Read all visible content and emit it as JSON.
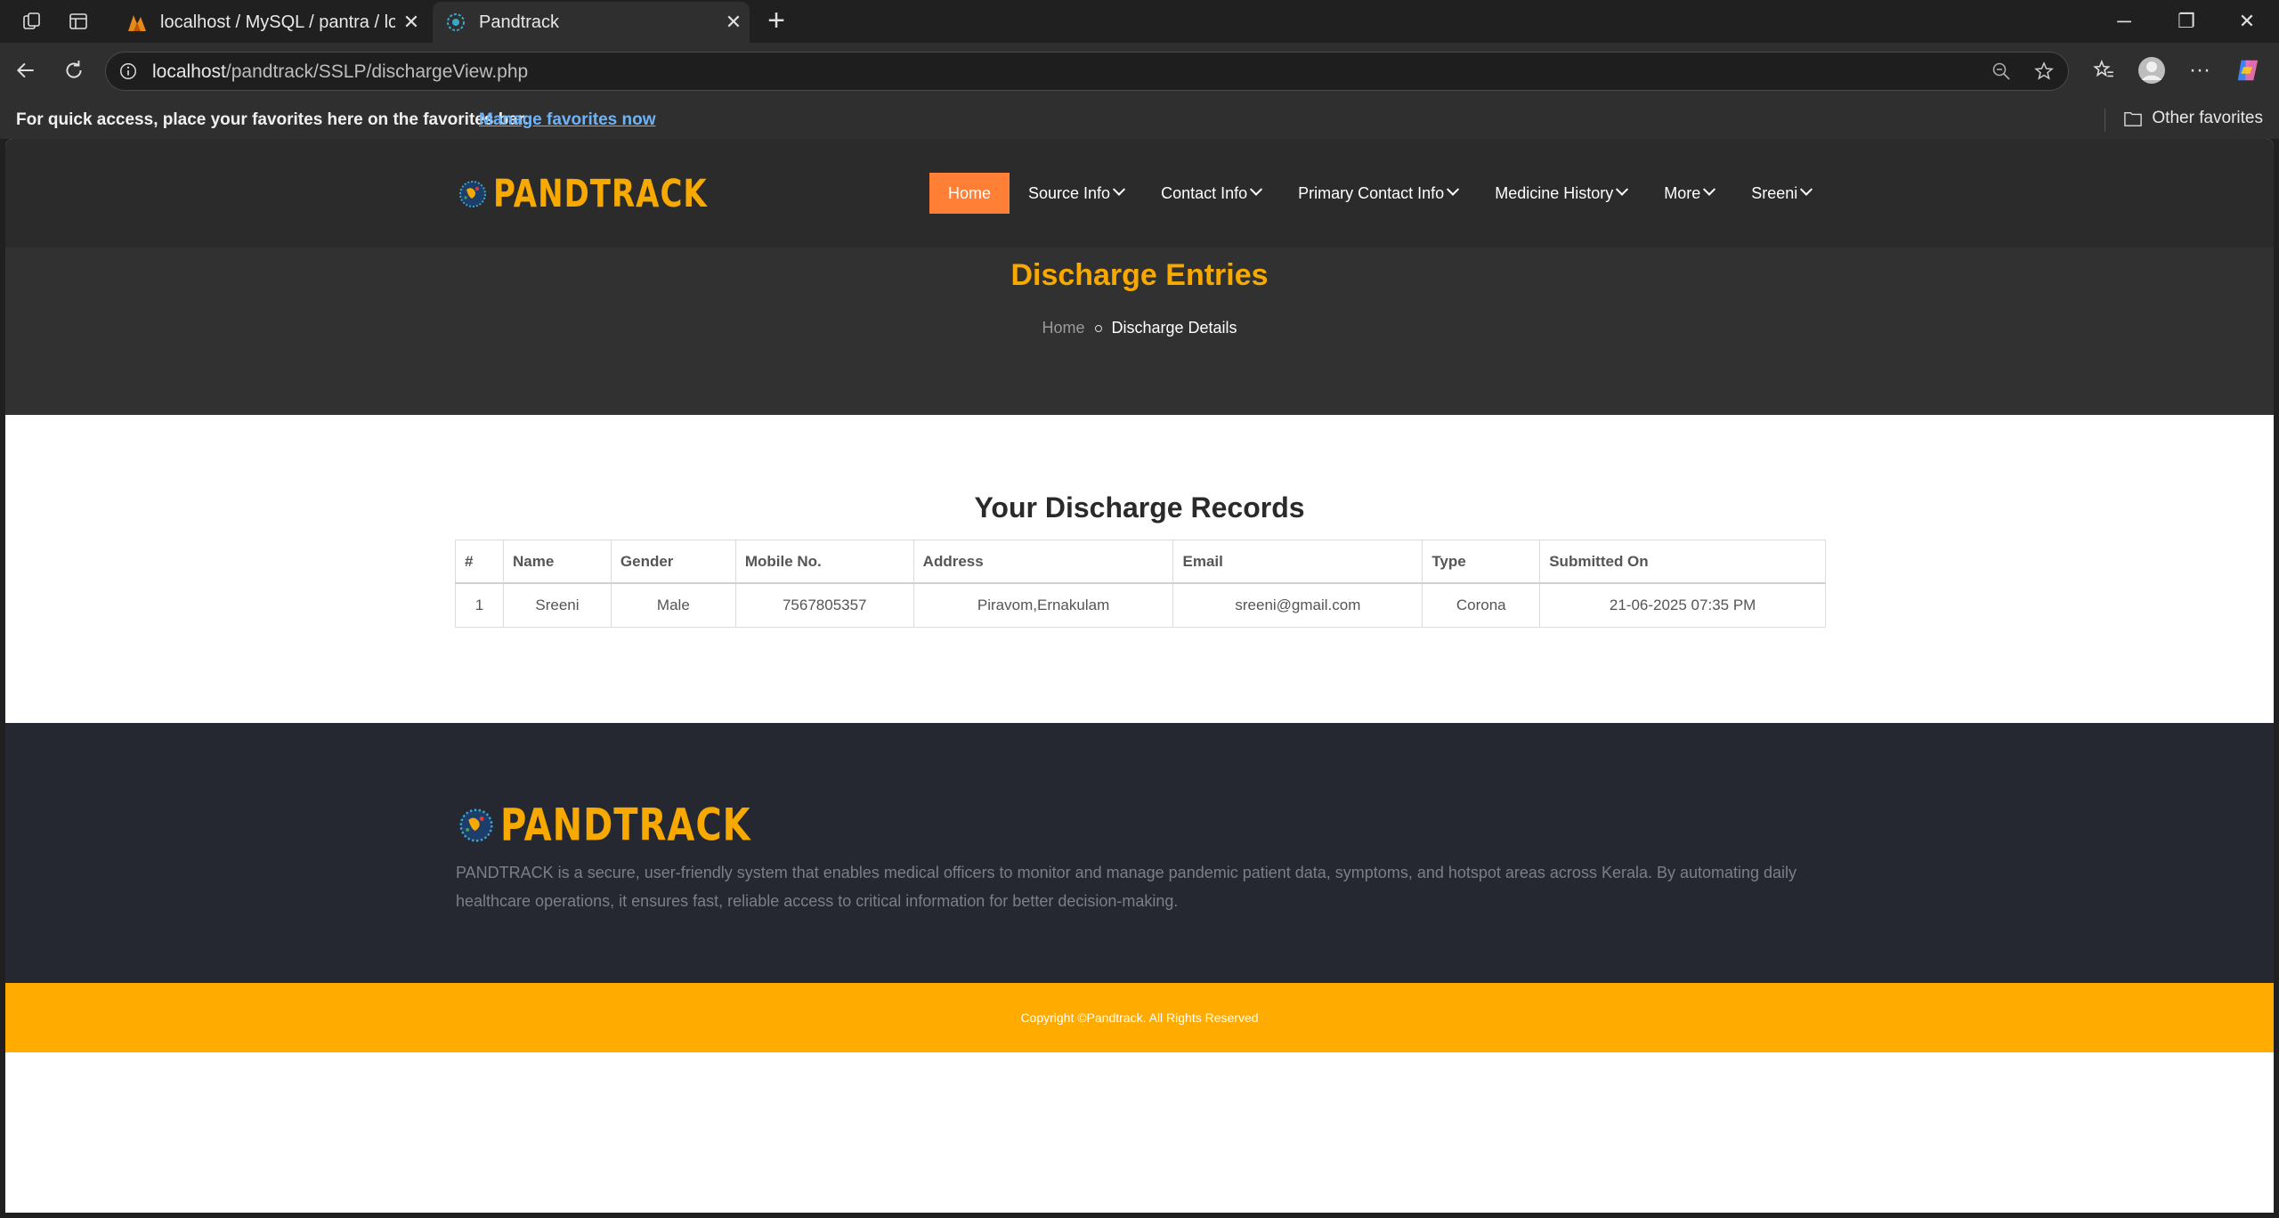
{
  "browser": {
    "tabs": [
      {
        "title": "localhost / MySQL / pantra / login",
        "active": false
      },
      {
        "title": "Pandtrack",
        "active": true
      }
    ],
    "url_host": "localhost",
    "url_path": "/pandtrack/SSLP/dischargeView.php",
    "favorites_bar": {
      "message": "For quick access, place your favorites here on the favorites bar.",
      "link": "Manage favorites now",
      "other": "Other favorites"
    }
  },
  "site": {
    "brand": "PANDTRACK",
    "nav": [
      {
        "label": "Home",
        "active": true,
        "dropdown": false
      },
      {
        "label": "Source Info",
        "active": false,
        "dropdown": true
      },
      {
        "label": "Contact Info",
        "active": false,
        "dropdown": true
      },
      {
        "label": "Primary Contact Info",
        "active": false,
        "dropdown": true
      },
      {
        "label": "Medicine History",
        "active": false,
        "dropdown": true
      },
      {
        "label": "More",
        "active": false,
        "dropdown": true
      },
      {
        "label": "Sreeni",
        "active": false,
        "dropdown": true
      }
    ],
    "hero": {
      "title": "Discharge Entries",
      "breadcrumb_home": "Home",
      "breadcrumb_current": "Discharge Details"
    },
    "records": {
      "heading": "Your Discharge Records",
      "columns": [
        "#",
        "Name",
        "Gender",
        "Mobile No.",
        "Address",
        "Email",
        "Type",
        "Submitted On"
      ],
      "rows": [
        [
          "1",
          "Sreeni",
          "Male",
          "7567805357",
          "Piravom,Ernakulam",
          "sreeni@gmail.com",
          "Corona",
          "21-06-2025 07:35 PM"
        ]
      ]
    },
    "footer": {
      "description": "PANDTRACK is a secure, user-friendly system that enables medical officers to monitor and manage pandemic patient data, symptoms, and hotspot areas across Kerala. By automating daily healthcare operations, it ensures fast, reliable access to critical information for better decision-making.",
      "copyright": "Copyright ©Pandtrack. All Rights Reserved"
    }
  },
  "colors": {
    "accent_orange": "#ff7f36",
    "brand_yellow": "#f7a900",
    "copy_bar": "#ffab00",
    "footer_bg": "#252830"
  }
}
